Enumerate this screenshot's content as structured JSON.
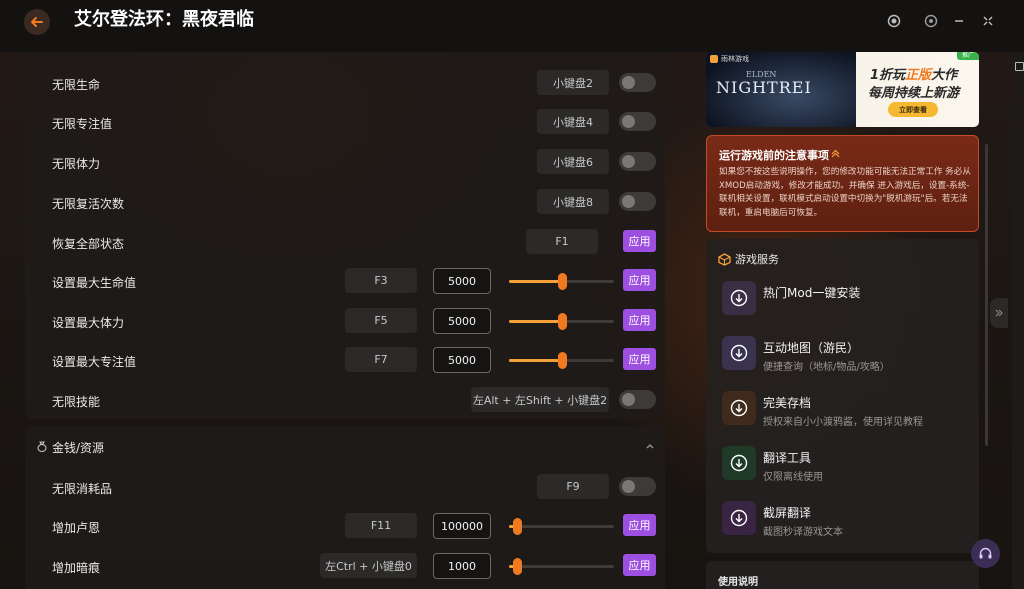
{
  "window": {
    "title": "艾尔登法环：黑夜君临"
  },
  "cheats": [
    {
      "label": "无限生命",
      "key": "小键盘2"
    },
    {
      "label": "无限专注值",
      "key": "小键盘4"
    },
    {
      "label": "无限体力",
      "key": "小键盘6"
    },
    {
      "label": "无限复活次数",
      "key": "小键盘8"
    },
    {
      "label": "恢复全部状态",
      "key": "F1",
      "action": "应用"
    },
    {
      "label": "设置最大生命值",
      "key": "F3",
      "value": "5000",
      "action": "应用",
      "slider_fraction": 0.5
    },
    {
      "label": "设置最大体力",
      "key": "F5",
      "value": "5000",
      "action": "应用",
      "slider_fraction": 0.5
    },
    {
      "label": "设置最大专注值",
      "key": "F7",
      "value": "5000",
      "action": "应用",
      "slider_fraction": 0.5
    },
    {
      "label": "无限技能",
      "key": "左Alt + 左Shift + 小键盘2"
    }
  ],
  "money_section": {
    "title": "金钱/资源",
    "items": [
      {
        "label": "无限消耗品",
        "key": "F9"
      },
      {
        "label": "增加卢恩",
        "key": "F11",
        "value": "100000",
        "action": "应用",
        "slider_fraction": 0.08
      },
      {
        "label": "增加暗痕",
        "key": "左Ctrl + 小键盘0",
        "value": "1000",
        "action": "应用",
        "slider_fraction": 0.08
      }
    ]
  },
  "ad": {
    "brand": "雨林游戏",
    "game_small": "ELDEN",
    "game": "NIGHTREI",
    "badge": "推广",
    "line1_a": "1折玩",
    "line1_hl": "正版",
    "line1_b": "大作",
    "line2": "每周持续上新游",
    "cta": "立即查看"
  },
  "notice": {
    "title": "运行游戏前的注意事项",
    "body": "如果您不按这些说明操作，您的修改功能可能无法正常工作 务必从XMOD启动游戏，修改才能成功。并确保 进入游戏后，设置-系统-联机相关设置，联机模式启动设置中切换为\"脱机游玩\"后。若无法联机，重启电脑后可恢复。"
  },
  "services": {
    "title": "游戏服务",
    "items": [
      {
        "title": "热门Mod一键安装",
        "sub": "",
        "color": "#3a2e44"
      },
      {
        "title": "互动地图（游民）",
        "sub": "便捷查询（地标/物品/攻略）",
        "color": "#3a3350"
      },
      {
        "title": "完美存档",
        "sub": "授权来自小小渡鸦酱，使用详见教程",
        "color": "#3f2a1c"
      },
      {
        "title": "翻译工具",
        "sub": "仅限离线使用",
        "color": "#1f3a26"
      },
      {
        "title": "截屏翻译",
        "sub": "截图秒译游戏文本",
        "color": "#3a2444"
      }
    ]
  },
  "usage": {
    "title": "使用说明"
  },
  "colors": {
    "accent_purple": "#9c4fe0",
    "slider_orange": "#f5a13a",
    "notice_red": "#7a2a18"
  }
}
